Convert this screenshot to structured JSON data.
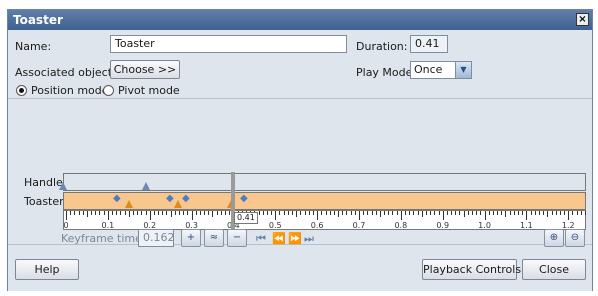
{
  "window": {
    "title": "Toaster"
  },
  "form": {
    "name_label": "Name:",
    "name_value": "Toaster",
    "duration_label": "Duration:",
    "duration_value": "0.41",
    "assoc_label": "Associated objects:",
    "choose_label": "Choose >>",
    "play_mode_label": "Play Mode:",
    "play_mode_value": "Once",
    "position_mode": "Position mode",
    "pivot_mode": "Pivot mode"
  },
  "timeline": {
    "tracks": [
      "Handle",
      "Toaster"
    ],
    "ticks": [
      "0",
      "0.1",
      "0.2",
      "0.3",
      "0.4",
      "0.5",
      "0.6",
      "0.7",
      "0.8",
      "0.9",
      "1.0",
      "1.1",
      "1.2"
    ],
    "current_time": "0.41"
  },
  "keyframe": {
    "label": "Keyframe time:",
    "value": "0.162"
  },
  "footer": {
    "help": "Help",
    "playback": "Playback Controls",
    "close": "Close"
  }
}
